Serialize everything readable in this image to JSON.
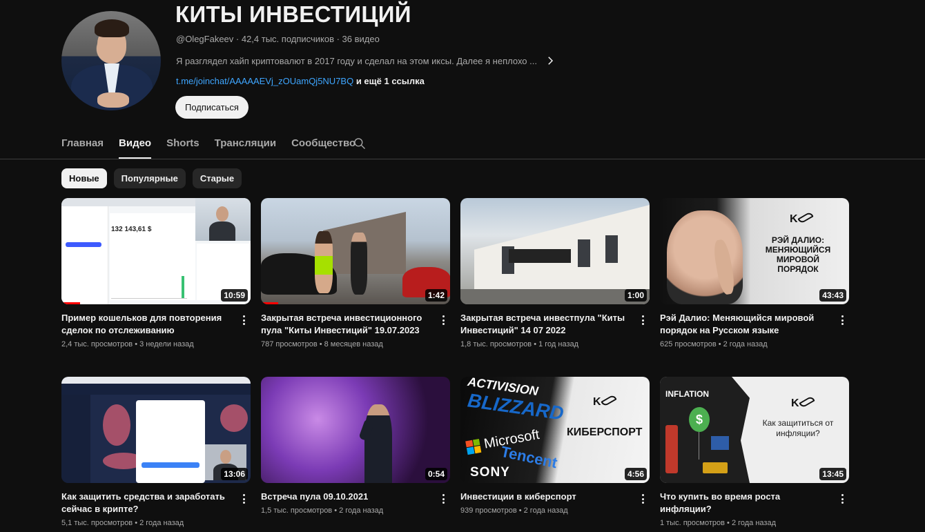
{
  "channel": {
    "title": "КИТЫ ИНВЕСТИЦИЙ",
    "meta": "@OlegFakeev · 42,4 тыс. подписчиков · 36 видео",
    "description": "Я разглядел хайп криптовалют в 2017 году и сделал на этом иксы. Далее я неплохо ...",
    "link": "t.me/joinchat/AAAAAEVj_zOUamQj5NU7BQ",
    "more_links": " и ещё 1 ссылка",
    "subscribe_label": "Подписаться"
  },
  "tabs": [
    "Главная",
    "Видео",
    "Shorts",
    "Трансляции",
    "Сообщество"
  ],
  "active_tab": "Видео",
  "chips": [
    "Новые",
    "Популярные",
    "Старые"
  ],
  "active_chip": "Новые",
  "videos": [
    {
      "title": "Пример кошельков для повторения сделок по отслеживанию",
      "meta": "2,4 тыс. просмотров • 3 недели назад",
      "duration": "10:59",
      "watched": 0.1
    },
    {
      "title": "Закрытая встреча инвестиционного пула \"Киты Инвестиций\" 19.07.2023",
      "meta": "787 просмотров • 8 месяцев назад",
      "duration": "1:42",
      "watched": 0.09
    },
    {
      "title": "Закрытая встреча инвестпула \"Киты Инвестиций\" 14 07 2022",
      "meta": "1,8 тыс. просмотров • 1 год назад",
      "duration": "1:00",
      "watched": 0
    },
    {
      "title": "Рэй Далио: Меняющийся мировой порядок на Русском языке",
      "meta": "625 просмотров • 2 года назад",
      "duration": "43:43",
      "watched": 0
    },
    {
      "title": "Как защитить средства и заработать сейчас в крипте?",
      "meta": "5,1 тыс. просмотров • 2 года назад",
      "duration": "13:06",
      "watched": 0
    },
    {
      "title": "Встреча пула 09.10.2021",
      "meta": "1,5 тыс. просмотров • 2 года назад",
      "duration": "0:54",
      "watched": 0
    },
    {
      "title": "Инвестиции в киберспорт",
      "meta": "939 просмотров • 2 года назад",
      "duration": "4:56",
      "watched": 0
    },
    {
      "title": "Что купить во время роста инфляции?",
      "meta": "1 тыс. просмотров • 2 года назад",
      "duration": "13:45",
      "watched": 0
    }
  ],
  "thumb_text": {
    "t1_amount": "132 143,61 $",
    "t4_text": "РЭЙ ДАЛИО: МЕНЯЮЩИЙСЯ МИРОВОЙ ПОРЯДОК",
    "t7_activision": "ACTIVISION",
    "t7_blizzard": "BLIZZARD",
    "t7_microsoft": "Microsoft",
    "t7_tencent": "Tencent",
    "t7_sony": "SONY",
    "t7_word": "КИБЕРСПОРТ",
    "t8_inflation": "INFLATION",
    "t8_dollar": "$",
    "t8_question": "Как защититься от инфляции?"
  },
  "colors": {
    "background": "#0f0f0f",
    "link": "#3ea6ff",
    "progress": "#ff0000"
  }
}
